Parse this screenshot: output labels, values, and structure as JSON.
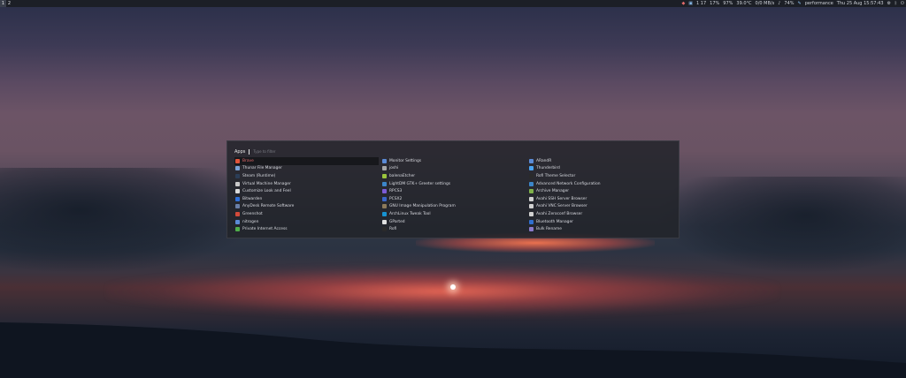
{
  "topbar": {
    "workspaces": [
      {
        "label": "1",
        "active": true
      },
      {
        "label": "2",
        "active": false
      }
    ],
    "tray": {
      "updates": "1 17",
      "memory": "17%",
      "battery": "97%",
      "temperature": "39.0°C",
      "network": "0/0 MB/s",
      "volume": "74%",
      "power_profile": "performance",
      "datetime": "Thu 25 Aug 15:57:43"
    }
  },
  "launcher": {
    "prompt": "Apps",
    "filter_placeholder": "Type to filter",
    "columns": [
      [
        {
          "label": "Brave",
          "icon": "brave-icon",
          "color": "#e0543a",
          "selected": true
        },
        {
          "label": "Thunar File Manager",
          "icon": "folder-icon",
          "color": "#7aa2d6"
        },
        {
          "label": "Steam (Runtime)",
          "icon": "steam-icon",
          "color": "#2b3d57"
        },
        {
          "label": "Virtual Machine Manager",
          "icon": "vm-icon",
          "color": "#c9c9c9"
        },
        {
          "label": "Customize Look and Feel",
          "icon": "appearance-icon",
          "color": "#d9d9d9"
        },
        {
          "label": "Bitwarden",
          "icon": "bitwarden-icon",
          "color": "#2e6fd8"
        },
        {
          "label": "AnyDesk Remote Software",
          "icon": "anydesk-icon",
          "color": "#6a7fa7"
        },
        {
          "label": "Greenshot",
          "icon": "greenshot-icon",
          "color": "#d24a3a"
        },
        {
          "label": "nitrogen",
          "icon": "nitrogen-icon",
          "color": "#5b8bd6"
        },
        {
          "label": "Private Internet Access",
          "icon": "pia-icon",
          "color": "#4fae4a"
        }
      ],
      [
        {
          "label": "Monitor Settings",
          "icon": "monitor-icon",
          "color": "#5b8bd6"
        },
        {
          "label": "joshi",
          "icon": "search-icon",
          "color": "#a7a7a7"
        },
        {
          "label": "balenaEtcher",
          "icon": "etcher-icon",
          "color": "#9bc53d"
        },
        {
          "label": "LightDM GTK+ Greeter settings",
          "icon": "lightdm-icon",
          "color": "#3c86c9"
        },
        {
          "label": "RPCS3",
          "icon": "rpcs3-icon",
          "color": "#7c5cd6"
        },
        {
          "label": "PCSX2",
          "icon": "pcsx2-icon",
          "color": "#3a66c9"
        },
        {
          "label": "GNU Image Manipulation Program",
          "icon": "gimp-icon",
          "color": "#8c7a5a"
        },
        {
          "label": "ArchLinux Tweak Tool",
          "icon": "arch-icon",
          "color": "#1793d1"
        },
        {
          "label": "GParted",
          "icon": "gparted-icon",
          "color": "#e0e0e0"
        },
        {
          "label": "Rofi",
          "icon": "rofi-icon",
          "color": "#2a2a2a"
        }
      ],
      [
        {
          "label": "ARandR",
          "icon": "arandr-icon",
          "color": "#5b8bd6"
        },
        {
          "label": "Thunderbird",
          "icon": "thunderbird-icon",
          "color": "#4aa3f0"
        },
        {
          "label": "Rofi Theme Selector",
          "icon": "rofi-theme-icon",
          "color": "#2a2a2a"
        },
        {
          "label": "Advanced Network Configuration",
          "icon": "network-icon",
          "color": "#3c86c9"
        },
        {
          "label": "Archive Manager",
          "icon": "archive-icon",
          "color": "#7fb24a"
        },
        {
          "label": "Avahi SSH Server Browser",
          "icon": "avahi-ssh-icon",
          "color": "#d0d0d0"
        },
        {
          "label": "Avahi VNC Server Browser",
          "icon": "avahi-vnc-icon",
          "color": "#d0d0d0"
        },
        {
          "label": "Avahi Zeroconf Browser",
          "icon": "avahi-zeroconf-icon",
          "color": "#d0d0d0"
        },
        {
          "label": "Bluetooth Manager",
          "icon": "bluetooth-icon",
          "color": "#2f6fd0"
        },
        {
          "label": "Bulk Rename",
          "icon": "bulk-rename-icon",
          "color": "#8a7acb"
        }
      ]
    ]
  }
}
